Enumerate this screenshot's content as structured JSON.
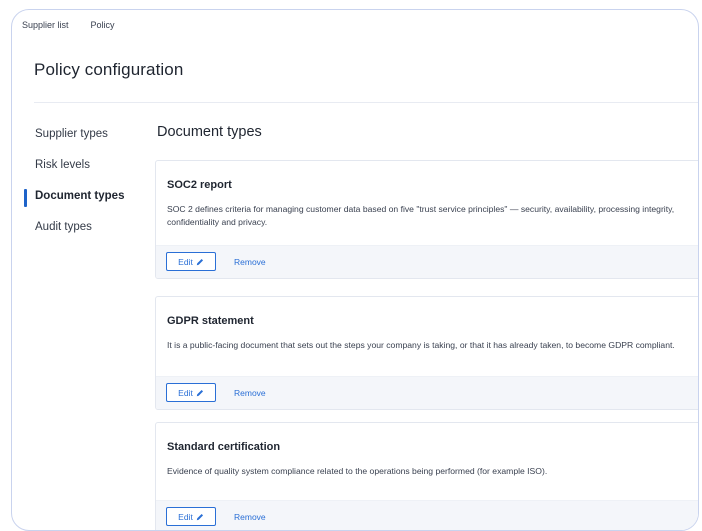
{
  "breadcrumbs": {
    "supplier_list": "Supplier list",
    "policy": "Policy"
  },
  "page_title": "Policy configuration",
  "sidebar": {
    "items": [
      {
        "label": "Supplier types",
        "active": false
      },
      {
        "label": "Risk levels",
        "active": false
      },
      {
        "label": "Document types",
        "active": true
      },
      {
        "label": "Audit types",
        "active": false
      }
    ]
  },
  "main": {
    "section_title": "Document types",
    "cards": [
      {
        "title": "SOC2 report",
        "description": "SOC 2 defines criteria for managing customer data based on five \"trust service principles\" — security, availability, processing integrity, confidentiality and privacy.",
        "edit_label": "Edit",
        "remove_label": "Remove"
      },
      {
        "title": "GDPR statement",
        "description": "It is a public-facing document that sets out the steps your company is taking, or that it has already taken, to become GDPR compliant.",
        "edit_label": "Edit",
        "remove_label": "Remove"
      },
      {
        "title": "Standard certification",
        "description": "Evidence of quality system compliance related to the operations being performed (for example ISO).",
        "edit_label": "Edit",
        "remove_label": "Remove"
      }
    ]
  },
  "colors": {
    "accent": "#1e63c9",
    "link": "#2a6fd6",
    "frame_border": "#c9d3ee",
    "card_footer": "#f4f6fa"
  },
  "icons": {
    "edit": "pencil-icon"
  }
}
